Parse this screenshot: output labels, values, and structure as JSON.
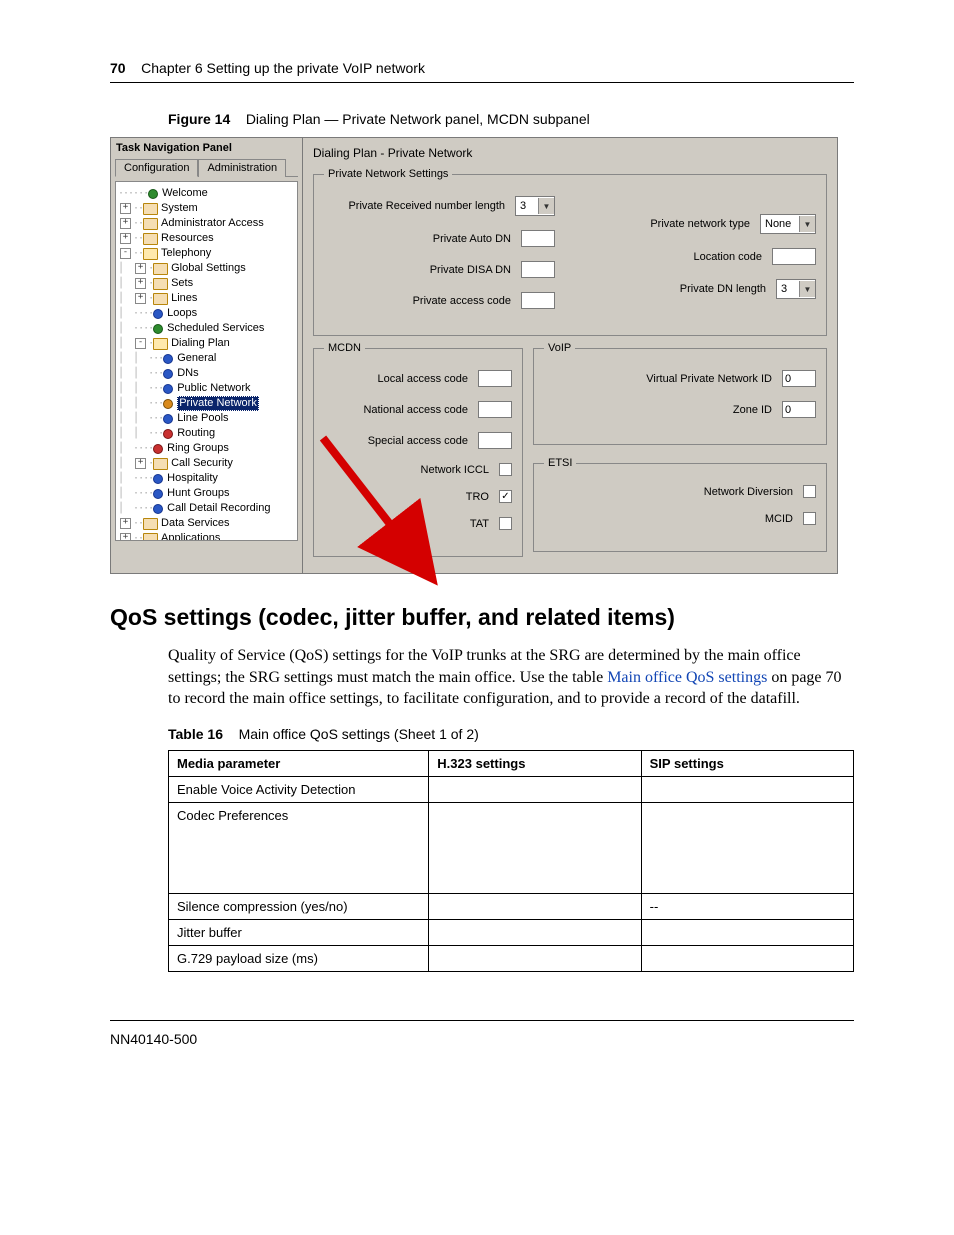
{
  "header": {
    "page_number": "70",
    "chapter": "Chapter 6  Setting up the private VoIP network"
  },
  "figure": {
    "label": "Figure 14",
    "caption": "Dialing Plan — Private Network panel, MCDN subpanel"
  },
  "nav_panel": {
    "title": "Task Navigation Panel",
    "tab_config": "Configuration",
    "tab_admin": "Administration"
  },
  "tree": {
    "welcome": "Welcome",
    "system": "System",
    "admin_access": "Administrator Access",
    "resources": "Resources",
    "telephony": "Telephony",
    "global_settings": "Global Settings",
    "sets": "Sets",
    "lines": "Lines",
    "loops": "Loops",
    "scheduled_services": "Scheduled Services",
    "dialing_plan": "Dialing Plan",
    "general": "General",
    "dns": "DNs",
    "public_network": "Public Network",
    "private_network": "Private Network",
    "line_pools": "Line Pools",
    "routing": "Routing",
    "ring_groups": "Ring Groups",
    "call_security": "Call Security",
    "hospitality": "Hospitality",
    "hunt_groups": "Hunt Groups",
    "cdr": "Call Detail Recording",
    "data_services": "Data Services",
    "applications": "Applications"
  },
  "panel": {
    "title": "Dialing Plan - Private Network",
    "group_settings": "Private Network Settings",
    "priv_recv_len_label": "Private Received number length",
    "priv_recv_len_value": "3",
    "priv_auto_dn_label": "Private Auto DN",
    "priv_disa_dn_label": "Private DISA DN",
    "priv_access_code_label": "Private access code",
    "priv_net_type_label": "Private network type",
    "priv_net_type_value": "None",
    "location_code_label": "Location code",
    "priv_dn_len_label": "Private DN length",
    "priv_dn_len_value": "3",
    "group_mcdn": "MCDN",
    "local_access_label": "Local access code",
    "national_access_label": "National access code",
    "special_access_label": "Special access code",
    "network_iccl_label": "Network ICCL",
    "tro_label": "TRO",
    "tat_label": "TAT",
    "tro_checked": true,
    "group_voip": "VoIP",
    "vpn_id_label": "Virtual Private Network ID",
    "vpn_id_value": "0",
    "zone_id_label": "Zone ID",
    "zone_id_value": "0",
    "group_etsi": "ETSI",
    "net_diversion_label": "Network Diversion",
    "mcid_label": "MCID"
  },
  "section": {
    "heading": "QoS settings (codec, jitter buffer, and related items)",
    "para_pre": "Quality of Service (QoS) settings for the VoIP trunks at the SRG are determined by the main office settings; the SRG settings must match the main office. Use the table ",
    "link": "Main office QoS settings",
    "para_post": " on page 70 to record the main office settings, to facilitate configuration, and to provide a record of the datafill."
  },
  "table": {
    "label": "Table 16",
    "caption": "Main office QoS settings (Sheet 1 of 2)",
    "headers": {
      "c1": "Media parameter",
      "c2": "H.323 settings",
      "c3": "SIP settings"
    },
    "rows": [
      {
        "c1": "Enable Voice Activity Detection",
        "c2": "",
        "c3": ""
      },
      {
        "c1": "Codec Preferences",
        "c2": "",
        "c3": "",
        "tall": true
      },
      {
        "c1": "Silence compression (yes/no)",
        "c2": "",
        "c3": "--"
      },
      {
        "c1": "Jitter buffer",
        "c2": "",
        "c3": ""
      },
      {
        "c1": "G.729 payload size (ms)",
        "c2": "",
        "c3": ""
      }
    ]
  },
  "footer": {
    "doc_id": "NN40140-500"
  }
}
